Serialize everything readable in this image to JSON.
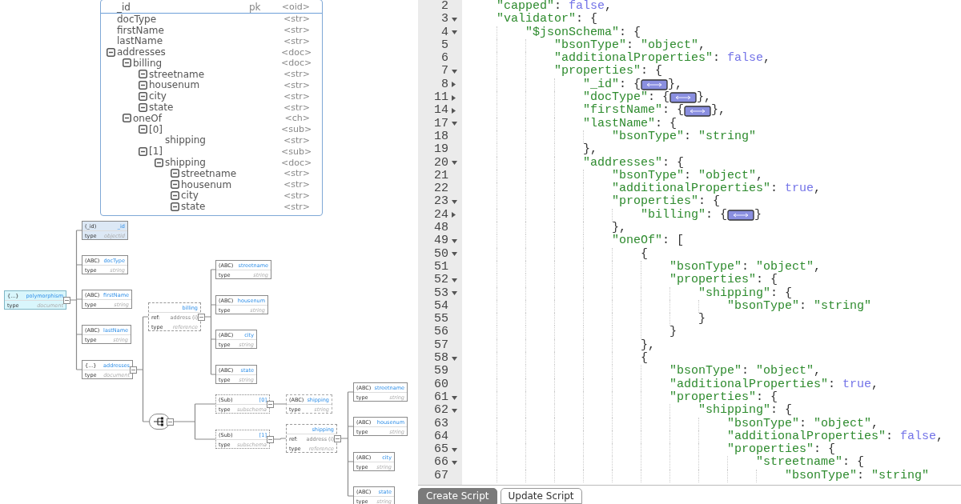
{
  "entity": {
    "fields": [
      {
        "name": "_id",
        "pk": "pk",
        "type": "<oid>",
        "expandable": false
      },
      {
        "name": "docType",
        "type": "<str>",
        "expandable": false
      },
      {
        "name": "firstName",
        "type": "<str>",
        "expandable": false
      },
      {
        "name": "lastName",
        "type": "<str>",
        "expandable": false
      },
      {
        "name": "addresses",
        "type": "<doc>",
        "expandable": true,
        "children": [
          {
            "name": "billing",
            "type": "<doc>",
            "expandable": true,
            "children": [
              {
                "name": "streetname",
                "type": "<str>",
                "expandable": true
              },
              {
                "name": "housenum",
                "type": "<str>",
                "expandable": true
              },
              {
                "name": "city",
                "type": "<str>",
                "expandable": true
              },
              {
                "name": "state",
                "type": "<str>",
                "expandable": true
              }
            ]
          },
          {
            "name": "oneOf",
            "type": "<ch>",
            "expandable": true,
            "children": [
              {
                "name": "[0]",
                "type": "<sub>",
                "expandable": true,
                "children": [
                  {
                    "name": "shipping",
                    "type": "<str>",
                    "expandable": false
                  }
                ]
              },
              {
                "name": "[1]",
                "type": "<sub>",
                "expandable": true,
                "children": [
                  {
                    "name": "shipping",
                    "type": "<doc>",
                    "expandable": true,
                    "children": [
                      {
                        "name": "streetname",
                        "type": "<str>",
                        "expandable": true
                      },
                      {
                        "name": "housenum",
                        "type": "<str>",
                        "expandable": true
                      },
                      {
                        "name": "city",
                        "type": "<str>",
                        "expandable": true
                      },
                      {
                        "name": "state",
                        "type": "<str>",
                        "expandable": true
                      }
                    ]
                  }
                ]
              }
            ]
          }
        ]
      }
    ]
  },
  "diagram": {
    "root": {
      "kind": "root",
      "badge": "{...}",
      "name": "polymorphism",
      "rows": [
        {
          "label": "type",
          "value": "document"
        }
      ],
      "children": [
        {
          "kind": "key",
          "badge": "(_id)",
          "name": "_id",
          "rows": [
            {
              "label": "type",
              "value": "objectid"
            }
          ]
        },
        {
          "kind": "field",
          "badge": "(ABC)",
          "name": "docType",
          "rows": [
            {
              "label": "type",
              "value": "string"
            }
          ]
        },
        {
          "kind": "field",
          "badge": "(ABC)",
          "name": "firstName",
          "rows": [
            {
              "label": "type",
              "value": "string"
            }
          ]
        },
        {
          "kind": "field",
          "badge": "(ABC)",
          "name": "lastName",
          "rows": [
            {
              "label": "type",
              "value": "string"
            }
          ]
        },
        {
          "kind": "field",
          "badge": "{...}",
          "name": "addresses",
          "rows": [
            {
              "label": "type",
              "value": "document"
            }
          ],
          "children": [
            {
              "kind": "reference",
              "name": "billing",
              "rows": [
                {
                  "label": "ref:",
                  "value": "address (i)"
                },
                {
                  "label": "type",
                  "value": "reference"
                }
              ],
              "children": [
                {
                  "kind": "field",
                  "badge": "(ABC)",
                  "name": "streetname",
                  "rows": [
                    {
                      "label": "type",
                      "value": "string"
                    }
                  ]
                },
                {
                  "kind": "field",
                  "badge": "(ABC)",
                  "name": "housenum",
                  "rows": [
                    {
                      "label": "type",
                      "value": "string"
                    }
                  ]
                },
                {
                  "kind": "field",
                  "badge": "(ABC)",
                  "name": "city",
                  "rows": [
                    {
                      "label": "type",
                      "value": "string"
                    }
                  ]
                },
                {
                  "kind": "field",
                  "badge": "(ABC)",
                  "name": "state",
                  "rows": [
                    {
                      "label": "type",
                      "value": "string"
                    }
                  ]
                }
              ]
            },
            {
              "kind": "choice",
              "children": [
                {
                  "kind": "subschema",
                  "badge": "(Sub)",
                  "name": "[0]",
                  "rows": [
                    {
                      "label": "type",
                      "value": "subschema"
                    }
                  ],
                  "children": [
                    {
                      "kind": "dashed-field",
                      "badge": "(ABC)",
                      "name": "shipping",
                      "rows": [
                        {
                          "label": "type",
                          "value": "string"
                        }
                      ]
                    }
                  ]
                },
                {
                  "kind": "subschema",
                  "badge": "(Sub)",
                  "name": "[1]",
                  "rows": [
                    {
                      "label": "type",
                      "value": "subschema"
                    }
                  ],
                  "children": [
                    {
                      "kind": "reference",
                      "name": "shipping",
                      "rows": [
                        {
                          "label": "ref:",
                          "value": "address (i)"
                        },
                        {
                          "label": "type",
                          "value": "reference"
                        }
                      ],
                      "children": [
                        {
                          "kind": "field",
                          "badge": "(ABC)",
                          "name": "streetname",
                          "rows": [
                            {
                              "label": "type",
                              "value": "string"
                            }
                          ]
                        },
                        {
                          "kind": "field",
                          "badge": "(ABC)",
                          "name": "housenum",
                          "rows": [
                            {
                              "label": "type",
                              "value": "string"
                            }
                          ]
                        },
                        {
                          "kind": "field",
                          "badge": "(ABC)",
                          "name": "city",
                          "rows": [
                            {
                              "label": "type",
                              "value": "string"
                            }
                          ]
                        },
                        {
                          "kind": "field",
                          "badge": "(ABC)",
                          "name": "state",
                          "rows": [
                            {
                              "label": "type",
                              "value": "string"
                            }
                          ]
                        }
                      ]
                    }
                  ]
                }
              ]
            }
          ]
        }
      ]
    }
  },
  "editor": {
    "lines": [
      {
        "number": "2",
        "kind": "plain",
        "text": "    \"capped\": false,"
      },
      {
        "number": "3",
        "kind": "open",
        "text": "    \"validator\": {"
      },
      {
        "number": "4",
        "kind": "open",
        "text": "        \"$jsonSchema\": {"
      },
      {
        "number": "5",
        "kind": "plain",
        "text": "            \"bsonType\": \"object\","
      },
      {
        "number": "6",
        "kind": "plain",
        "text": "            \"additionalProperties\": false,"
      },
      {
        "number": "7",
        "kind": "open",
        "text": "            \"properties\": {"
      },
      {
        "number": "8",
        "kind": "folded",
        "text": "                \"_id\": {",
        "after": "},"
      },
      {
        "number": "11",
        "kind": "folded",
        "text": "                \"docType\": {",
        "after": "},"
      },
      {
        "number": "14",
        "kind": "folded",
        "text": "                \"firstName\": {",
        "after": "},"
      },
      {
        "number": "17",
        "kind": "open",
        "text": "                \"lastName\": {"
      },
      {
        "number": "18",
        "kind": "plain",
        "text": "                    \"bsonType\": \"string\""
      },
      {
        "number": "19",
        "kind": "plain",
        "text": "                },"
      },
      {
        "number": "20",
        "kind": "open",
        "text": "                \"addresses\": {"
      },
      {
        "number": "21",
        "kind": "plain",
        "text": "                    \"bsonType\": \"object\","
      },
      {
        "number": "22",
        "kind": "plain",
        "text": "                    \"additionalProperties\": true,"
      },
      {
        "number": "23",
        "kind": "open",
        "text": "                    \"properties\": {"
      },
      {
        "number": "24",
        "kind": "folded",
        "text": "                        \"billing\": {",
        "after": "}"
      },
      {
        "number": "48",
        "kind": "plain",
        "text": "                    },"
      },
      {
        "number": "49",
        "kind": "open",
        "text": "                    \"oneOf\": ["
      },
      {
        "number": "50",
        "kind": "open",
        "text": "                        {"
      },
      {
        "number": "51",
        "kind": "plain",
        "text": "                            \"bsonType\": \"object\","
      },
      {
        "number": "52",
        "kind": "open",
        "text": "                            \"properties\": {"
      },
      {
        "number": "53",
        "kind": "open",
        "text": "                                \"shipping\": {"
      },
      {
        "number": "54",
        "kind": "plain",
        "text": "                                    \"bsonType\": \"string\""
      },
      {
        "number": "55",
        "kind": "plain",
        "text": "                                }"
      },
      {
        "number": "56",
        "kind": "plain",
        "text": "                            }"
      },
      {
        "number": "57",
        "kind": "plain",
        "text": "                        },"
      },
      {
        "number": "58",
        "kind": "open",
        "text": "                        {"
      },
      {
        "number": "59",
        "kind": "plain",
        "text": "                            \"bsonType\": \"object\","
      },
      {
        "number": "60",
        "kind": "plain",
        "text": "                            \"additionalProperties\": true,"
      },
      {
        "number": "61",
        "kind": "open",
        "text": "                            \"properties\": {"
      },
      {
        "number": "62",
        "kind": "open",
        "text": "                                \"shipping\": {"
      },
      {
        "number": "63",
        "kind": "plain",
        "text": "                                    \"bsonType\": \"object\","
      },
      {
        "number": "64",
        "kind": "plain",
        "text": "                                    \"additionalProperties\": false,"
      },
      {
        "number": "65",
        "kind": "open",
        "text": "                                    \"properties\": {"
      },
      {
        "number": "66",
        "kind": "open",
        "text": "                                        \"streetname\": {"
      },
      {
        "number": "67",
        "kind": "plain",
        "text": "                                            \"bsonType\": \"string\""
      }
    ]
  },
  "buttons": [
    {
      "label": "Create Script",
      "kind": "filled"
    },
    {
      "label": "Update Script",
      "kind": "outline"
    }
  ]
}
